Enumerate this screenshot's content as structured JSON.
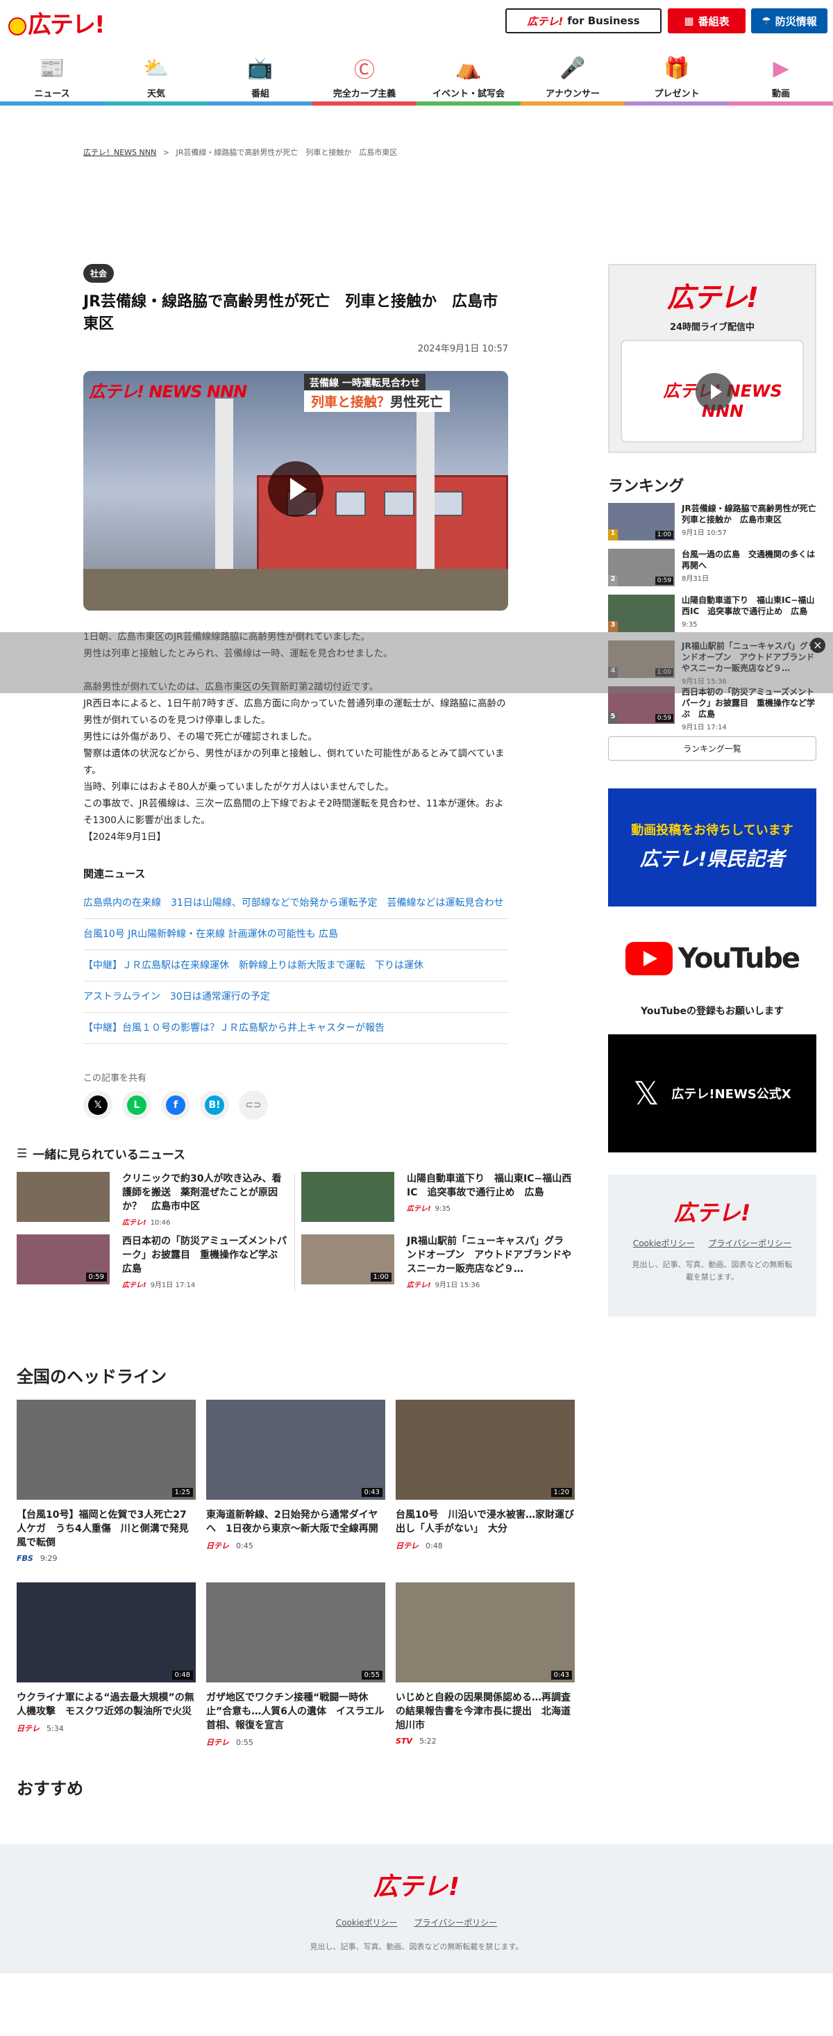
{
  "header": {
    "logo": "広テレ!",
    "for_business": {
      "prefix": "広テレ!",
      "label": "for Business"
    },
    "program_guide": "番組表",
    "disaster": "防災情報"
  },
  "nav": [
    {
      "label": "ニュース",
      "icon": "newspaper-icon",
      "glyph": "📰",
      "color": "#3aa1d9"
    },
    {
      "label": "天気",
      "icon": "weather-icon",
      "glyph": "⛅",
      "color": "#33b3c7"
    },
    {
      "label": "番組",
      "icon": "tv-icon",
      "glyph": "📺",
      "color": "#4c9bdd"
    },
    {
      "label": "完全カープ主義",
      "icon": "carp-icon",
      "glyph": "Ⓒ",
      "color": "#e94949"
    },
    {
      "label": "イベント・試写会",
      "icon": "tent-icon",
      "glyph": "⛺",
      "color": "#58b95b"
    },
    {
      "label": "アナウンサー",
      "icon": "microphone-icon",
      "glyph": "🎤",
      "color": "#f0a13a"
    },
    {
      "label": "プレゼント",
      "icon": "gift-icon",
      "glyph": "🎁",
      "color": "#b189d6"
    },
    {
      "label": "動画",
      "icon": "video-icon",
      "glyph": "▶",
      "color": "#e87ab0"
    }
  ],
  "breadcrumb": {
    "home": "広テレ！NEWS NNN",
    "separator": ">",
    "current": "JR芸備線・線路脇で高齢男性が死亡　列車と接触か　広島市東区"
  },
  "article": {
    "category": "社会",
    "title": "JR芸備線・線路脇で高齢男性が死亡　列車と接触か　広島市東区",
    "date": "2024年9月1日 10:57",
    "video": {
      "logo": "広テレ! NEWS NNN",
      "caption_top": "芸備線 一時運転見合わせ",
      "caption_main_red": "列車と接触？",
      "caption_main": "男性死亡"
    },
    "paragraphs": [
      "1日朝、広島市東区のJR芸備線線路脇に高齢男性が倒れていました。",
      "男性は列車と接触したとみられ、芸備線は一時、運転を見合わせました。",
      "",
      "高齢男性が倒れていたのは、広島市東区の矢賀新町第2踏切付近です。",
      "JR西日本によると、1日午前7時すぎ、広島方面に向かっていた普通列車の運転士が、線路脇に高齢の男性が倒れているのを見つけ停車しました。",
      "男性には外傷があり、その場で死亡が確認されました。",
      "警察は遺体の状況などから、男性がほかの列車と接触し、倒れていた可能性があるとみて調べています。",
      "当時、列車にはおよそ80人が乗っていましたがケガ人はいませんでした。",
      "この事故で、JR芸備線は、三次ー広島間の上下線でおよそ2時間運転を見合わせ、11本が運休。およそ1300人に影響が出ました。",
      "【2024年9月1日】"
    ]
  },
  "related": {
    "heading": "関連ニュース",
    "items": [
      "広島県内の在来線　31日は山陽線、可部線などで始発から運転予定　芸備線などは運転見合わせ",
      "台風10号 JR山陽新幹線・在来線 計画運休の可能性も 広島",
      "【中継】ＪＲ広島駅は在来線運休　新幹線上りは新大阪まで運転　下りは運休",
      "アストラムライン　30日は通常運行の予定",
      "【中継】台風１０号の影響は？ＪＲ広島駅から井上キャスターが報告"
    ]
  },
  "share": {
    "heading": "この記事を共有",
    "buttons": [
      {
        "name": "x-share-icon",
        "glyph": "𝕏",
        "color": "#000000"
      },
      {
        "name": "line-share-icon",
        "glyph": "L",
        "color": "#06c755"
      },
      {
        "name": "facebook-share-icon",
        "glyph": "f",
        "color": "#1877f2"
      },
      {
        "name": "hatena-share-icon",
        "glyph": "B!",
        "color": "#00a4de"
      },
      {
        "name": "link-copy-icon",
        "glyph": "⊂⊃",
        "color": "#999999"
      }
    ]
  },
  "sidebar": {
    "live": {
      "logo": "広テレ!",
      "status": "24時間ライブ配信中",
      "thumb_logo": "広テレ! NEWS NNN"
    },
    "ranking": {
      "heading": "ランキング",
      "items": [
        {
          "rank": "1",
          "title": "JR芸備線・線路脇で高齢男性が死亡　列車と接触か　広島市東区",
          "time": "9月1日 10:57",
          "duration": "1:00",
          "rank_color": "#d4a017"
        },
        {
          "rank": "2",
          "title": "台風一過の広島　交通機関の多くは再開へ",
          "time": "8月31日",
          "duration": "0:59",
          "rank_color": "#999999"
        },
        {
          "rank": "3",
          "title": "山陽自動車道下り　福山東IC−福山西IC　追突事故で通行止め　広島",
          "time": "9:35",
          "duration": "",
          "rank_color": "#b0733b"
        },
        {
          "rank": "4",
          "title": "JR福山駅前「ニューキャスパ」グランドオープン　アウトドアブランドやスニーカー販売店など９…",
          "time": "9月1日 15:36",
          "duration": "1:00",
          "rank_color": "#666666"
        },
        {
          "rank": "5",
          "title": "西日本初の「防災アミューズメントパーク」お披露目　重機操作など学ぶ　広島",
          "time": "9月1日 17:14",
          "duration": "0:59",
          "rank_color": "#666666"
        }
      ],
      "all_label": "ランキング一覧"
    },
    "reporter_banner": {
      "line1": "動画投稿をお待ちしています",
      "line2": "広テレ!県民記者"
    },
    "youtube": {
      "label": "YouTube",
      "subscribe": "YouTubeの登録もお願いします"
    },
    "x_banner": {
      "label": "広テレ!NEWS公式X"
    },
    "footer": {
      "logo": "広テレ!",
      "links": [
        "Cookieポリシー",
        "プライバシーポリシー"
      ],
      "copyright": "見出し、記事、写真、動画、図表などの無断転載を禁じます。"
    }
  },
  "popular": {
    "heading": "一緒に見られているニュース",
    "items": [
      {
        "title": "クリニックで約30人が吹き込み、看護師を搬送　薬剤混ぜたことが原因か？　広島市中区",
        "source": "広テレ!",
        "time": "10:46",
        "duration": "",
        "thumb": "#7a6a5a"
      },
      {
        "title": "山陽自動車道下り　福山東IC−福山西IC　追突事故で通行止め　広島",
        "source": "広テレ!",
        "time": "9:35",
        "duration": "",
        "thumb": "#4a6b4a"
      },
      {
        "title": "西日本初の「防災アミューズメントパーク」お披露目　重機操作など学ぶ　広島",
        "source": "広テレ!",
        "time": "9月1日 17:14",
        "duration": "0:59",
        "thumb": "#8a5a6a"
      },
      {
        "title": "JR福山駅前「ニューキャスパ」グランドオープン　アウトドアブランドやスニーカー販売店など９…",
        "source": "広テレ!",
        "time": "9月1日 15:36",
        "duration": "1:00",
        "thumb": "#9a8a7a"
      }
    ]
  },
  "national": {
    "heading": "全国のヘッドライン",
    "items": [
      {
        "title": "【台風10号】福岡と佐賀で3人死亡27人ケガ　うち4人重傷　川と側溝で発見　風で転倒",
        "source": "FBS",
        "time": "9:29",
        "duration": "1:25",
        "thumb": "#6b6b6b",
        "source_color": "#1a4aa0"
      },
      {
        "title": "東海道新幹線、2日始発から通常ダイヤへ　1日夜から東京〜新大阪で全線再開",
        "source": "日テレ",
        "time": "0:45",
        "duration": "0:43",
        "thumb": "#5a6070",
        "source_color": "#e60012"
      },
      {
        "title": "台風10号　川沿いで浸水被害…家財運び出し「人手がない」　大分",
        "source": "日テレ",
        "time": "0:48",
        "duration": "1:20",
        "thumb": "#6a5a4a",
        "source_color": "#e60012"
      },
      {
        "title": "ウクライナ軍による“過去最大規模”の無人機攻撃　モスクワ近郊の製油所で火災",
        "source": "日テレ",
        "time": "5:34",
        "duration": "0:48",
        "thumb": "#2a3040",
        "source_color": "#e60012"
      },
      {
        "title": "ガザ地区でワクチン接種“戦闘一時休止”合意も…人質6人の遺体　イスラエル首相、報復を宣言",
        "source": "日テレ",
        "time": "0:55",
        "duration": "0:55",
        "thumb": "#707070",
        "source_color": "#e60012"
      },
      {
        "title": "いじめと自殺の因果関係認める…再調査の結果報告書を今津市長に提出　北海道旭川市",
        "source": "STV",
        "time": "5:22",
        "duration": "0:43",
        "thumb": "#8a8070",
        "source_color": "#e60012"
      }
    ]
  },
  "recommended": {
    "heading": "おすすめ"
  },
  "footer": {
    "logo": "広テレ!",
    "links": [
      "Cookieポリシー",
      "プライバシーポリシー"
    ],
    "copyright": "見出し、記事、写真、動画、図表などの無断転載を禁じます。"
  },
  "overlay": {
    "close": "×"
  }
}
